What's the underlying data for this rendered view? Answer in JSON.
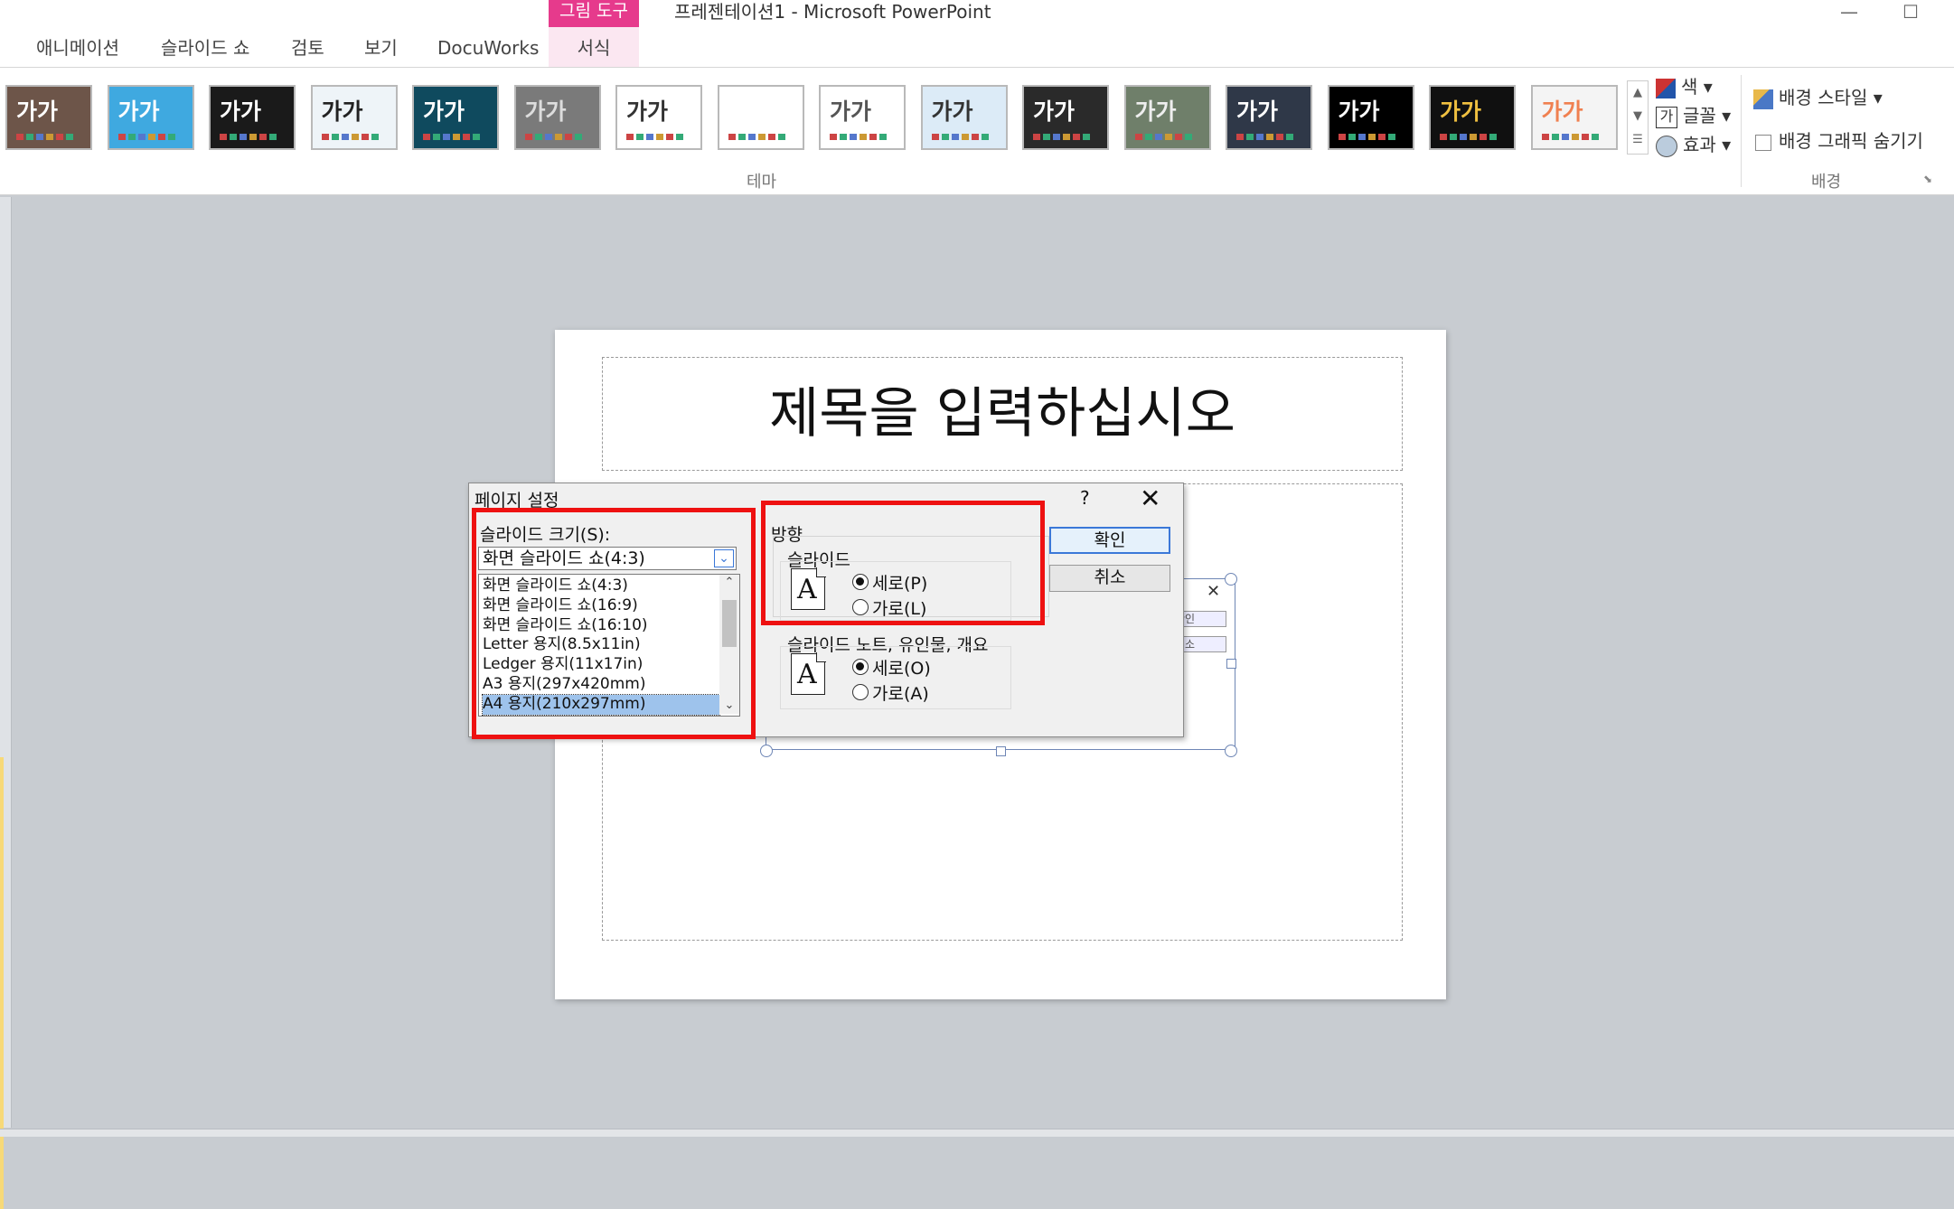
{
  "window": {
    "title": "프레젠테이션1  -  Microsoft PowerPoint",
    "minimize_glyph": "—",
    "maximize_glyph": "☐"
  },
  "tabs": [
    {
      "label": "애니메이션"
    },
    {
      "label": "슬라이드 쇼"
    },
    {
      "label": "검토"
    },
    {
      "label": "보기"
    },
    {
      "label": "DocuWorks"
    }
  ],
  "context_tab": {
    "group_label": "그림 도구",
    "tab_label": "서식",
    "color": "#e63a8c"
  },
  "ribbon": {
    "themes_group_label": "테마",
    "theme_letters": "가가",
    "theme_count": 16,
    "theme_options": {
      "colors": "색",
      "fonts": "글꼴",
      "effects": "효과"
    },
    "background_group_label": "배경",
    "background_styles": "배경 스타일",
    "hide_background_graphics": "배경 그래픽 숨기기",
    "hide_background_graphics_checked": false
  },
  "slide": {
    "title_placeholder": "제목을 입력하십시오",
    "embedded_dialog_buttons": [
      "확인",
      "취소"
    ]
  },
  "dialog": {
    "title": "페이지 설정",
    "help": "?",
    "close": "✕",
    "slide_size_label": "슬라이드 크기(S):",
    "slide_size_value": "화면 슬라이드 쇼(4:3)",
    "slide_size_options": [
      "화면 슬라이드 쇼(4:3)",
      "화면 슬라이드 쇼(16:9)",
      "화면 슬라이드 쇼(16:10)",
      "Letter 용지(8.5x11in)",
      "Ledger 용지(11x17in)",
      "A3 용지(297x420mm)",
      "A4 용지(210x297mm)"
    ],
    "highlighted_option": "A4 용지(210x297mm)",
    "orientation_label": "방향",
    "slides_label": "슬라이드",
    "slides_portrait": "세로(P)",
    "slides_landscape": "가로(L)",
    "slides_selected": "portrait",
    "notes_label": "슬라이드 노트, 유인물, 개요",
    "notes_portrait": "세로(O)",
    "notes_landscape": "가로(A)",
    "notes_selected": "portrait",
    "ok": "확인",
    "cancel": "취소"
  },
  "highlight_color": "#ee1111"
}
